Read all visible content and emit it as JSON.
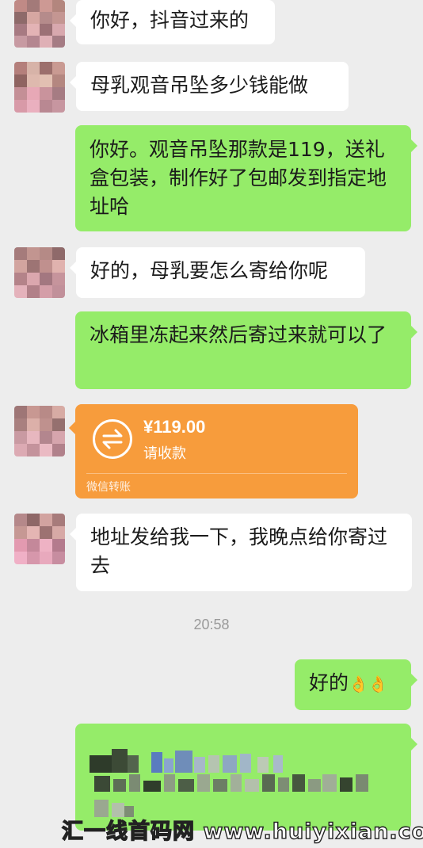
{
  "messages": {
    "m1": "你好，抖音过来的",
    "m2": "母乳观音吊坠多少钱能做",
    "m3": "你好。观音吊坠那款是119，送礼盒包装，制作好了包邮发到指定地址哈",
    "m4": "好的，母乳要怎么寄给你呢",
    "m5": "冰箱里冻起来然后寄过来就可以了",
    "m6": "地址发给我一下，我晚点给你寄过去",
    "m7": "好的"
  },
  "transfer": {
    "amount": "¥119.00",
    "status": "请收款",
    "footer": "微信转账"
  },
  "timestamp": "20:58",
  "watermark": "汇一线首码网 www.huiyixian.com",
  "colors": {
    "background": "#ededed",
    "sent_bubble": "#95ec69",
    "received_bubble": "#ffffff",
    "transfer_card": "#f79c3c"
  },
  "icons": {
    "transfer": "exchange-arrows-icon",
    "emoji": "ok-hand-emoji"
  }
}
